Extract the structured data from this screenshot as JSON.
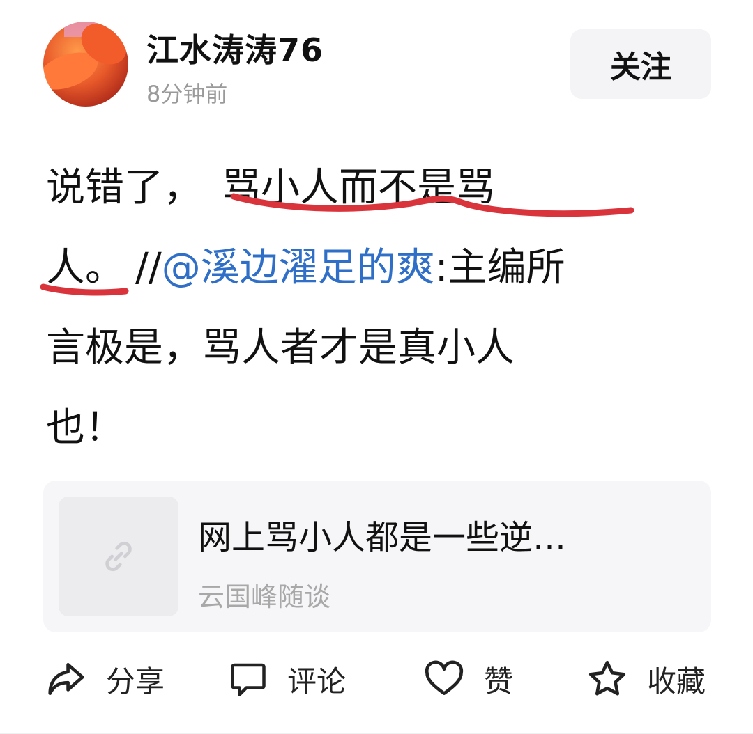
{
  "post": {
    "author": "江水涛涛76",
    "time": "8分钟前",
    "follow_label": "关注",
    "content_lines": [
      {
        "pre": "说错了，",
        "underlined": "骂小人而不是骂"
      },
      {
        "pre": "",
        "underlined": "人。",
        "middle": "//",
        "mention": "@溪边濯足的爽",
        "post": ":主编所"
      },
      {
        "text": "言极是，骂人者才是真小人"
      },
      {
        "text": "也！"
      }
    ],
    "annotation_color": "#d9343b"
  },
  "link_card": {
    "title": "网上骂小人都是一些逆…",
    "source": "云国峰随谈",
    "icon": "link-icon"
  },
  "actions": [
    {
      "icon": "share-icon",
      "label": "分享"
    },
    {
      "icon": "comment-icon",
      "label": "评论"
    },
    {
      "icon": "like-icon",
      "label": "赞"
    },
    {
      "icon": "star-icon",
      "label": "收藏"
    }
  ],
  "colors": {
    "mention": "#2f6fc8",
    "muted": "#9a9a9a",
    "button_bg": "#f4f4f6"
  }
}
